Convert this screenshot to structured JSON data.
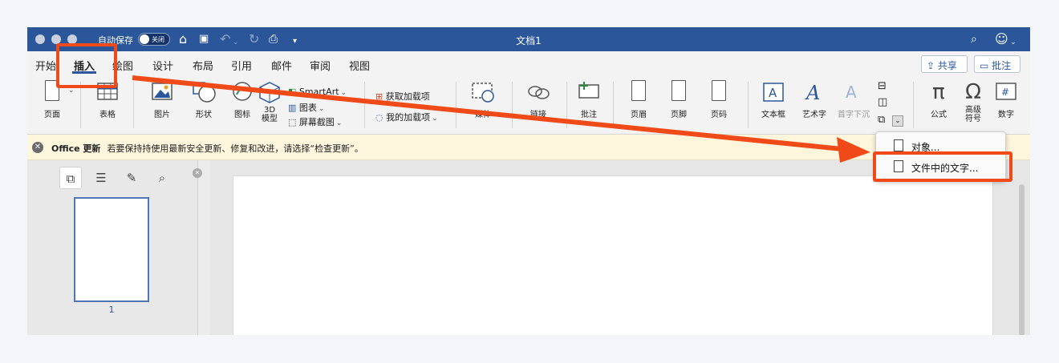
{
  "window": {
    "autosave_label": "自动保存",
    "autosave_state": "关闭",
    "doc_title": "文档1"
  },
  "tabs": [
    "开始",
    "插入",
    "绘图",
    "设计",
    "布局",
    "引用",
    "邮件",
    "审阅",
    "视图"
  ],
  "header_buttons": {
    "share": "共享",
    "comment": "批注"
  },
  "ribbon": {
    "page": "页面",
    "table": "表格",
    "picture": "图片",
    "shape": "形状",
    "icon": "图标",
    "model3d": "3D\n模型",
    "smartart": "SmartArt",
    "chart": "图表",
    "screenshot": "屏幕截图",
    "get_addins": "获取加载项",
    "my_addins": "我的加载项",
    "media": "媒体",
    "link": "链接",
    "comment": "批注",
    "header": "页眉",
    "footer": "页脚",
    "page_number": "页码",
    "textbox": "文本框",
    "wordart": "艺术字",
    "dropcap": "首字下沉",
    "equation": "公式",
    "symbol": "高级\n符号",
    "number": "数字"
  },
  "infobar": {
    "title": "Office 更新",
    "message": "若要保持持使用最新安全更新、修复和改进，请选择“检查更新”。"
  },
  "pages_pane": {
    "page_number": "1"
  },
  "object_menu": {
    "items": [
      "对象...",
      "文件中的文字..."
    ]
  },
  "annotation": {
    "color": "#f04a18"
  }
}
